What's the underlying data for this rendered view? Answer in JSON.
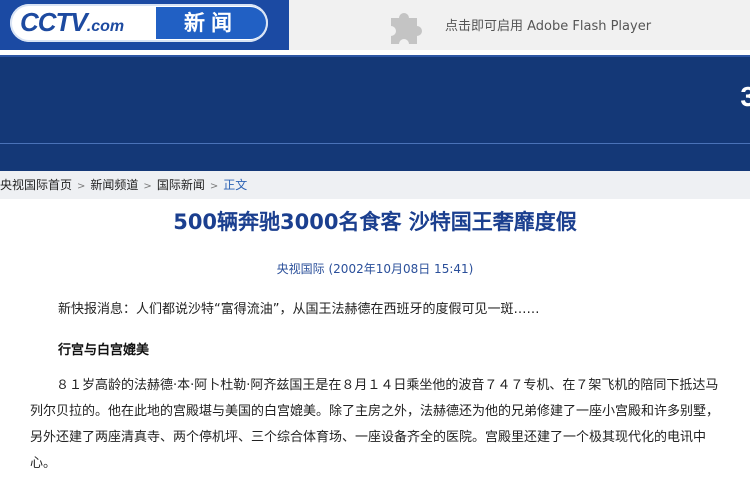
{
  "header": {
    "logo_text": "CCTV",
    "logo_suffix": ".com",
    "channel_label": "新闻",
    "flash_notice": "点击即可启用 Adobe Flash Player"
  },
  "banner": {
    "partial_text": "3"
  },
  "breadcrumb": {
    "items": [
      "央视国际首页",
      "新闻频道",
      "国际新闻"
    ],
    "current": "正文",
    "separator": ">"
  },
  "article": {
    "title": "500辆奔驰3000名食客 沙特国王奢靡度假",
    "meta": "央视国际 (2002年10月08日 15:41)",
    "lead": "新快报消息：人们都说沙特“富得流油”，从国王法赫德在西班牙的度假可见一斑……",
    "subhead": "行宫与白宫媲美",
    "paragraph": "８１岁高龄的法赫德·本·阿卜杜勒·阿齐兹国王是在８月１４日乘坐他的波音７４７专机、在７架飞机的陪同下抵达马列尔贝拉的。他在此地的宫殿堪与美国的白宫媲美。除了主房之外，法赫德还为他的兄弟修建了一座小宫殿和许多别墅，另外还建了两座清真寺、两个停机坪、三个综合体育场、一座设备齐全的医院。宫殿里还建了一个极其现代化的电讯中心。"
  },
  "colors": {
    "brand_blue": "#1b4aa3",
    "banner_blue": "#143877",
    "title_blue": "#1b3f8f",
    "link_blue": "#2d63b5"
  },
  "icons": {
    "plugin": "puzzle-piece-icon"
  }
}
